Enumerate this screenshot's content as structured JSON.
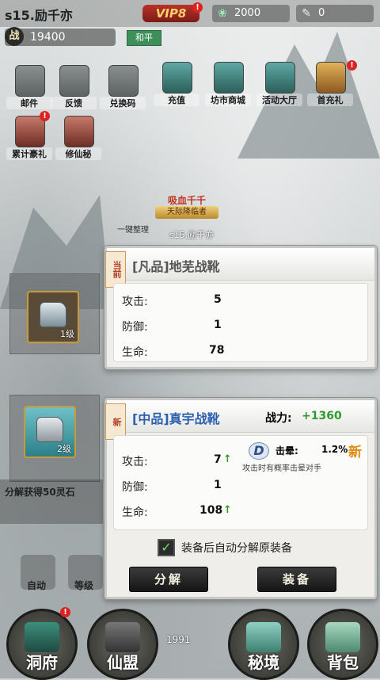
{
  "topbar": {
    "server_name": "s15.励千亦",
    "vip_label": "VIP8",
    "vip_badge": "!",
    "jade_amount": "2000",
    "item_amount": "0"
  },
  "player": {
    "power_char": "战",
    "power_value": "19400",
    "peace_label": "和平",
    "character_name": "s15.励千亦",
    "guild_title": "吸血千千",
    "guild_subtitle": "天际降临者",
    "tidy_label": "一键整理"
  },
  "features": [
    {
      "label": "邮件",
      "badge": ""
    },
    {
      "label": "反馈",
      "badge": ""
    },
    {
      "label": "兑换码",
      "badge": ""
    },
    {
      "label": "充值",
      "badge": ""
    },
    {
      "label": "坊市商城",
      "badge": ""
    },
    {
      "label": "活动大厅",
      "badge": ""
    },
    {
      "label": "首充礼",
      "badge": "!"
    },
    {
      "label": "累计豪礼",
      "badge": "!"
    },
    {
      "label": "修仙秘",
      "badge": ""
    }
  ],
  "slot_old": {
    "level": "1级"
  },
  "slot_new": {
    "level": "2级"
  },
  "panel_current": {
    "tag": "当前",
    "title": "[凡品]地芜战靴",
    "stats": [
      {
        "label": "攻击:",
        "value": "5"
      },
      {
        "label": "防御:",
        "value": "1"
      },
      {
        "label": "生命:",
        "value": "78"
      }
    ]
  },
  "panel_new": {
    "tag": "新",
    "title": "[中品]真宇战靴",
    "power_label": "战力:",
    "power_delta": "+1360",
    "stats": [
      {
        "label": "攻击:",
        "value": "7",
        "up": "↑"
      },
      {
        "label": "防御:",
        "value": "1",
        "up": ""
      },
      {
        "label": "生命:",
        "value": "108",
        "up": "↑"
      }
    ],
    "skill": {
      "icon": "D",
      "name": "击晕:",
      "chance": "1.2%",
      "badge": "新",
      "desc": "攻击时有概率击晕对手"
    },
    "auto_decompose": "装备后自动分解原装备",
    "decompose_button": "分解",
    "equip_button": "装备"
  },
  "left_menu": {
    "banner": "分解获得50灵石",
    "auto_label": "自动",
    "grade_label": "等级"
  },
  "bottom_nav": [
    {
      "label": "洞府",
      "badge": "!"
    },
    {
      "label": "仙盟",
      "badge": ""
    },
    {
      "label": "秘境",
      "badge": ""
    },
    {
      "label": "背包",
      "badge": ""
    }
  ],
  "bottom_coins": "1991",
  "colors": {
    "accent_green": "#2c9a2c",
    "vip_red": "#b8332a",
    "gold": "#c99a3a"
  }
}
